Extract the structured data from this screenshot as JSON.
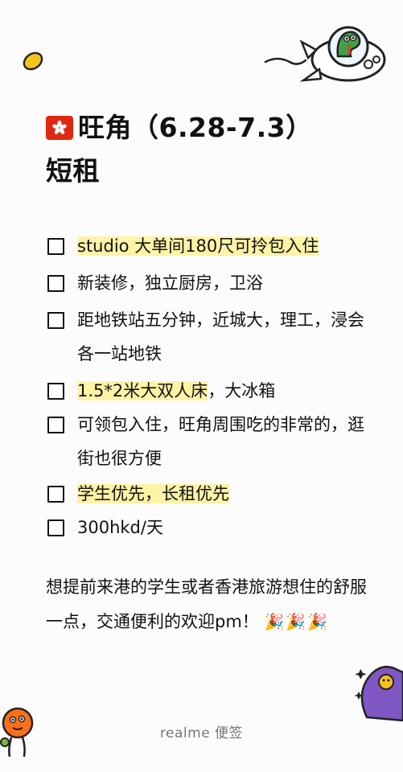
{
  "note": {
    "title_line1": "旺角（6.28-7.3）",
    "title_line2": "短租",
    "items": [
      {
        "text": "studio 大单间180尺可拎包入住",
        "highlighted": true
      },
      {
        "text": "新装修，独立厨房，卫浴",
        "highlighted": false
      },
      {
        "text": "距地铁站五分钟，近城大，理工，浸会各一站地铁",
        "highlighted": false
      },
      {
        "text_highlighted": "1.5*2米大双人床",
        "text_rest": "，大冰箱",
        "highlighted": "partial"
      },
      {
        "text": "可领包入住，旺角周围吃的非常的，逛街也很方便",
        "highlighted": false
      },
      {
        "text": "学生优先，长租优先",
        "highlighted": true
      },
      {
        "text": "300hkd/天",
        "highlighted": false
      }
    ],
    "body_text": "想提前来港的学生或者香港旅游想住的舒服一点，交通便利的欢迎pm！",
    "emoji": "🎉🎉🎉"
  },
  "footer": {
    "label": "realme 便签"
  },
  "colors": {
    "highlight": "#fff3a6",
    "flag": "#de2910"
  },
  "icons": [
    "hong-kong-flag-icon",
    "checkbox-icon",
    "party-popper-icon",
    "dinosaur-rocket-sticker",
    "bean-sticker",
    "orange-bird-sticker",
    "purple-blob-sticker"
  ]
}
